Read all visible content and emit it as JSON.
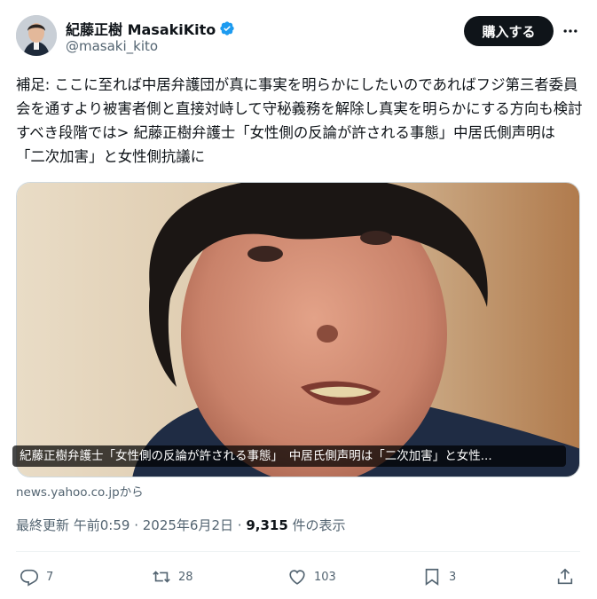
{
  "author": {
    "display_name": "紀藤正樹 MasakiKito",
    "handle": "@masaki_kito",
    "verified_icon": "verified-badge-icon"
  },
  "header": {
    "buy_label": "購入する",
    "more_icon": "more-dots-icon"
  },
  "tweet": {
    "text": "補足: ここに至れば中居弁護団が真に事実を明らかにしたいのであればフジ第三者委員会を通すより被害者側と直接対峙して守秘義務を解除し真実を明らかにする方向も検討すべき段階では> 紀藤正樹弁護士「女性側の反論が許される事態」中居氏側声明は「二次加害」と女性側抗議に"
  },
  "card": {
    "caption": "紀藤正樹弁護士「女性側の反論が許される事態」　中居氏側声明は「二次加害」と女性...",
    "source": "news.yahoo.co.jpから"
  },
  "meta": {
    "updated_prefix": "最終更新 午前0:59 · 2025年6月2日 · ",
    "views_count": "9,315",
    "views_suffix": " 件の表示"
  },
  "actions": {
    "reply_count": "7",
    "retweet_count": "28",
    "like_count": "103",
    "bookmark_count": "3"
  },
  "colors": {
    "text": "#0f1419",
    "secondary": "#536471",
    "verified": "#1d9bf0",
    "divider": "#eff3f4"
  }
}
